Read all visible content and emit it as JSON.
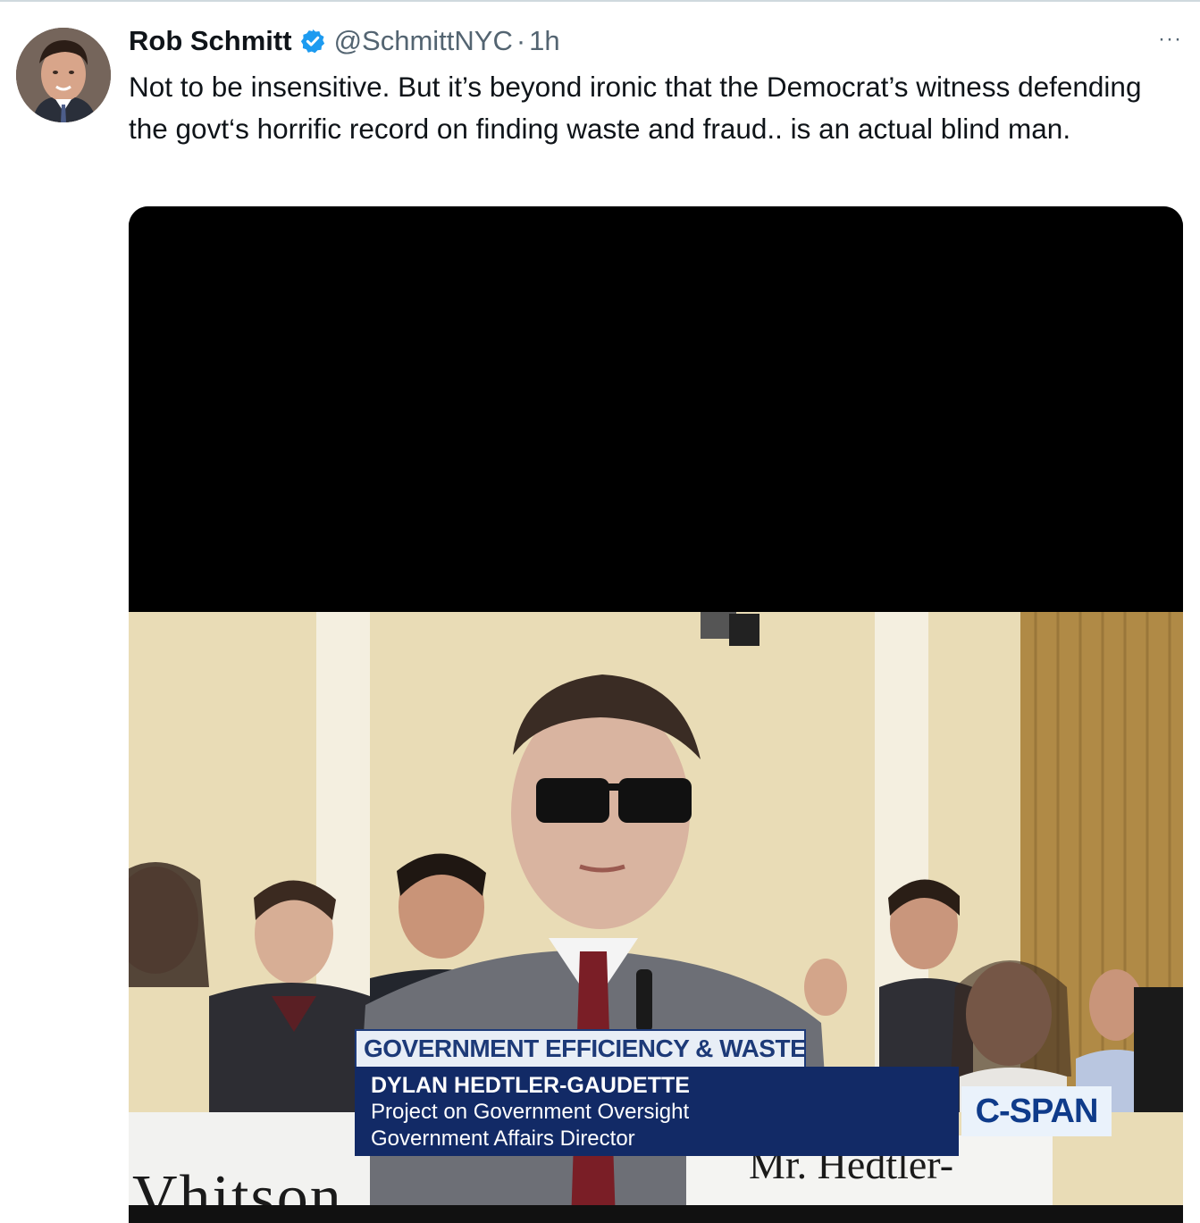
{
  "tweet": {
    "display_name": "Rob Schmitt",
    "handle": "@SchmittNYC",
    "separator": "·",
    "time": "1h",
    "more": "···",
    "text": "Not to be insensitive.  But it’s beyond ironic that the Democrat’s witness defending the govt‘s horrific record on finding waste and fraud.. is an actual blind man."
  },
  "media": {
    "lower_third": {
      "title": "GOVERNMENT EFFICIENCY & WASTE",
      "name": "DYLAN HEDTLER-GAUDETTE",
      "organization": "Project on Government Oversight",
      "role": "Government Affairs Director"
    },
    "network": "C-SPAN",
    "nameplate_left": "Vhitson",
    "nameplate_right": "Mr. Hedtler-"
  },
  "colors": {
    "verified": "#1d9bf0",
    "secondary_text": "#536471",
    "lower_third_navy": "#122a66"
  },
  "icons": {
    "verified": "verified-badge-icon",
    "more": "more-dots-icon"
  }
}
